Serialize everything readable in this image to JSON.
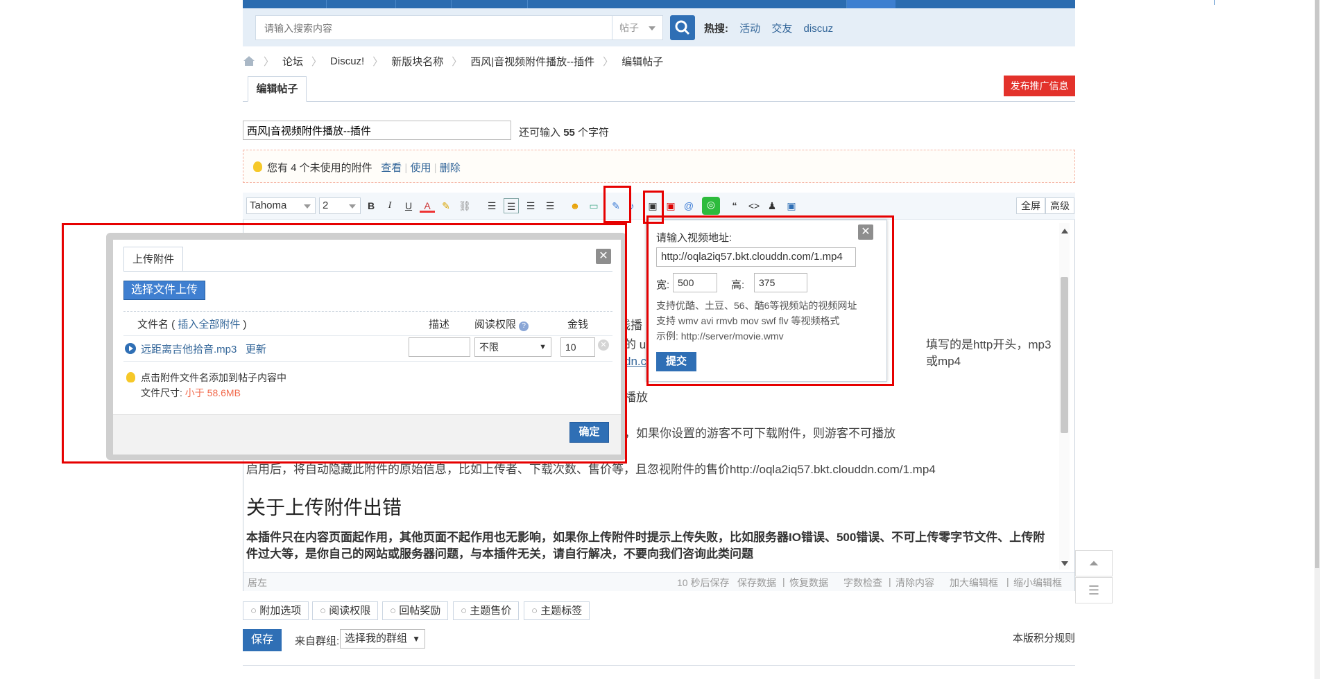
{
  "search": {
    "placeholder": "请输入搜索内容",
    "type": "帖子",
    "hot_label": "热搜:",
    "hot": [
      "活动",
      "交友",
      "discuz"
    ]
  },
  "breadcrumb": [
    "论坛",
    "Discuz!",
    "新版块名称",
    "西风|音视频附件播放--插件",
    "编辑帖子"
  ],
  "tab": {
    "label": "编辑帖子"
  },
  "promo": {
    "label": "发布推广信息"
  },
  "subject": {
    "value": "西风|音视频附件播放--插件",
    "tip_pre": "还可输入",
    "count": "55",
    "tip_post": "个字符"
  },
  "attach_notice": {
    "text": "您有 4 个未使用的附件",
    "view": "查看",
    "use": "使用",
    "delete": "删除",
    "sep": "|"
  },
  "toolbar": {
    "font": "Tahoma",
    "size": "2",
    "fullscreen": "全屏",
    "advanced": "高级"
  },
  "content": {
    "line_frag1": "在线播",
    "line_frag2": "的 u",
    "line_frag2b": "填写的是http开头，mp3或mp4",
    "line_frag3": "dn.co",
    "line_frag4": "播放",
    "line_frag5": "，如果你设置的游客不可下载附件，则游客不可播放",
    "line6": "启用后，将自动隐藏此附件的原始信息，比如上传者、下载次数、售价等，且忽视附件的售价http://oqla2iq57.bkt.clouddn.com/1.mp4",
    "heading": "关于上传附件出错",
    "bold_para": "本插件只在内容页面起作用，其他页面不起作用也无影响，如果你上传附件时提示上传失败，比如服务器IO错误、500错误、不可上传零字节文件、上传附件过大等，是你自己的网站或服务器问题，与本插件无关，请自行解决，不要向我们咨询此类问题"
  },
  "statusbar": {
    "left": "居左",
    "autosave": "10 秒后保存",
    "save_data": "保存数据",
    "restore": "恢复数据",
    "wordcheck": "字数检查",
    "clear": "清除内容",
    "enlarge": "加大编辑框",
    "shrink": "缩小编辑框",
    "sep": "|"
  },
  "options": [
    "附加选项",
    "阅读权限",
    "回帖奖励",
    "主题售价",
    "主题标签"
  ],
  "save": {
    "label": "保存"
  },
  "group": {
    "label": "来自群组:",
    "select": "选择我的群组"
  },
  "rules": {
    "label": "本版积分规则"
  },
  "upload_dialog": {
    "tab": "上传附件",
    "choose": "选择文件上传",
    "col_filename": "文件名 (",
    "insert_all": "插入全部附件",
    "col_filename_close": ")",
    "col_desc": "描述",
    "col_perm": "阅读权限",
    "col_price": "金钱",
    "file_name": "远距离吉他拾音.mp3",
    "update": "更新",
    "perm_value": "不限",
    "price_value": "10",
    "tip": "点击附件文件名添加到帖子内容中",
    "size_label": "文件尺寸:",
    "size_value": "小于 58.6MB",
    "confirm": "确定"
  },
  "video_dialog": {
    "title": "请输入视频地址:",
    "url": "http://oqla2iq57.bkt.clouddn.com/1.mp4",
    "width_label": "宽:",
    "width": "500",
    "height_label": "高:",
    "height": "375",
    "support1": "支持优酷、土豆、56、酷6等视频站的视频网址",
    "support2": "支持 wmv avi rmvb mov swf flv 等视频格式",
    "example": "示例: http://server/movie.wmv",
    "submit": "提交"
  },
  "colors": {
    "accent": "#2f6fb5",
    "promo": "#e3322b",
    "highlight": "#e60000"
  }
}
